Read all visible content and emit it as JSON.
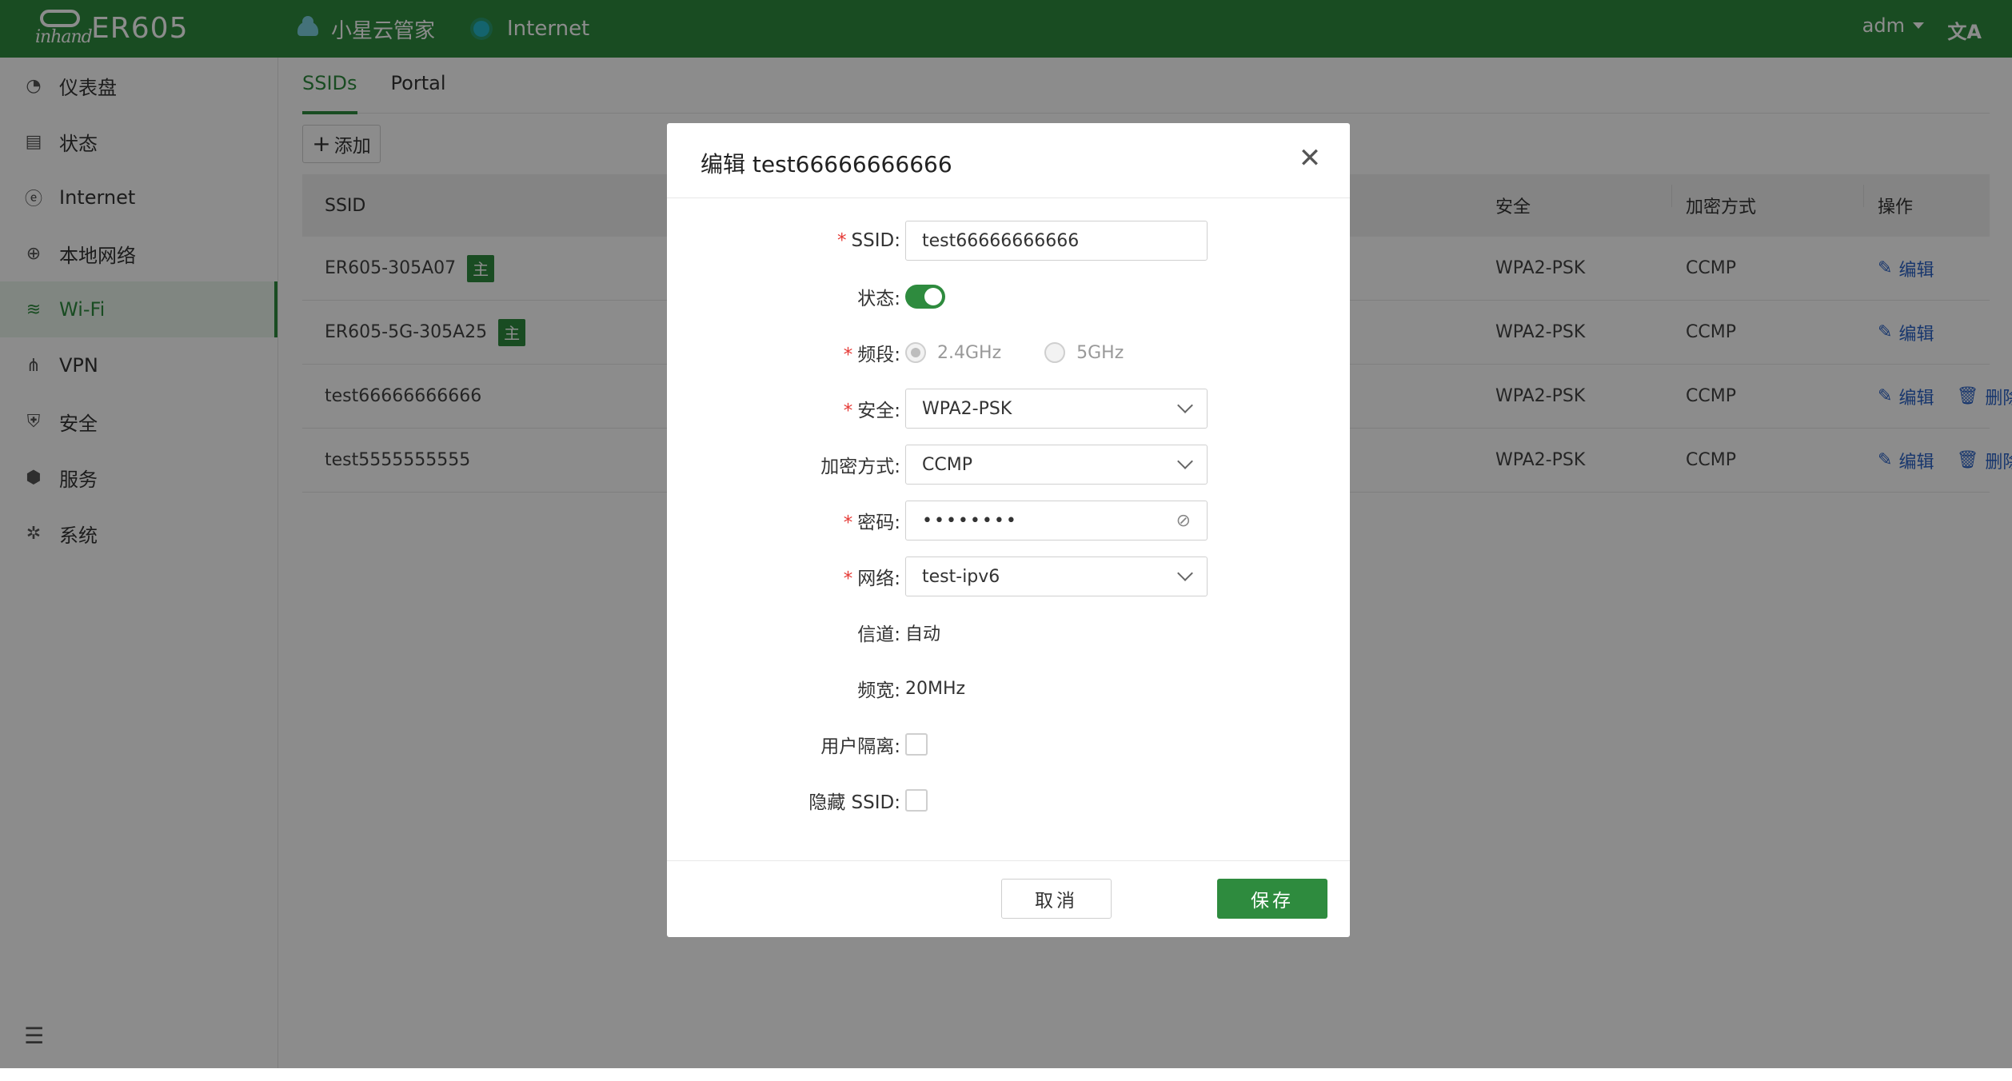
{
  "app": {
    "brand": "inhand",
    "model": "ER605"
  },
  "topnav": {
    "cloud_label": "小星云管家",
    "internet_label": "Internet",
    "user": "adm",
    "lang_icon": "translate-icon"
  },
  "sidebar": {
    "items": [
      {
        "label": "仪表盘",
        "icon": "dashboard-icon"
      },
      {
        "label": "状态",
        "icon": "status-icon"
      },
      {
        "label": "Internet",
        "icon": "internet-icon"
      },
      {
        "label": "本地网络",
        "icon": "globe-icon"
      },
      {
        "label": "Wi-Fi",
        "icon": "wifi-icon",
        "active": true
      },
      {
        "label": "VPN",
        "icon": "vpn-icon"
      },
      {
        "label": "安全",
        "icon": "shield-icon"
      },
      {
        "label": "服务",
        "icon": "box-icon"
      },
      {
        "label": "系统",
        "icon": "gear-icon"
      }
    ]
  },
  "tabs": [
    {
      "label": "SSIDs",
      "active": true
    },
    {
      "label": "Portal"
    }
  ],
  "toolbar": {
    "add_label": "添加"
  },
  "table": {
    "headers": {
      "ssid": "SSID",
      "security": "安全",
      "encryption": "加密方式",
      "ops": "操作"
    },
    "main_badge": "主",
    "edit_label": "编辑",
    "delete_label": "删除",
    "rows": [
      {
        "ssid": "ER605-305A07",
        "main": true,
        "partial": "l",
        "security": "WPA2-PSK",
        "encryption": "CCMP",
        "deletable": false
      },
      {
        "ssid": "ER605-5G-305A25",
        "main": true,
        "partial": "l",
        "security": "WPA2-PSK",
        "encryption": "CCMP",
        "deletable": false
      },
      {
        "ssid": "test66666666666",
        "main": false,
        "partial": "l",
        "security": "WPA2-PSK",
        "encryption": "CCMP",
        "deletable": true
      },
      {
        "ssid": "test5555555555",
        "main": false,
        "partial": "l",
        "security": "WPA2-PSK",
        "encryption": "CCMP",
        "deletable": true
      }
    ]
  },
  "modal": {
    "title": "编辑 test66666666666",
    "fields": {
      "ssid_label": "SSID:",
      "ssid_value": "test66666666666",
      "status_label": "状态:",
      "band_label": "频段:",
      "band_opt1": "2.4GHz",
      "band_opt2": "5GHz",
      "security_label": "安全:",
      "security_value": "WPA2-PSK",
      "encryption_label": "加密方式:",
      "encryption_value": "CCMP",
      "password_label": "密码:",
      "password_value": "••••••••",
      "network_label": "网络:",
      "network_value": "test-ipv6",
      "channel_label": "信道:",
      "channel_value": "自动",
      "bandwidth_label": "频宽:",
      "bandwidth_value": "20MHz",
      "isolation_label": "用户隔离:",
      "hide_ssid_label": "隐藏 SSID:"
    },
    "cancel_label": "取消",
    "save_label": "保存"
  },
  "colors": {
    "brand_green": "#2e8b3e",
    "link_blue": "#2b63c7",
    "required_red": "#e53935"
  }
}
